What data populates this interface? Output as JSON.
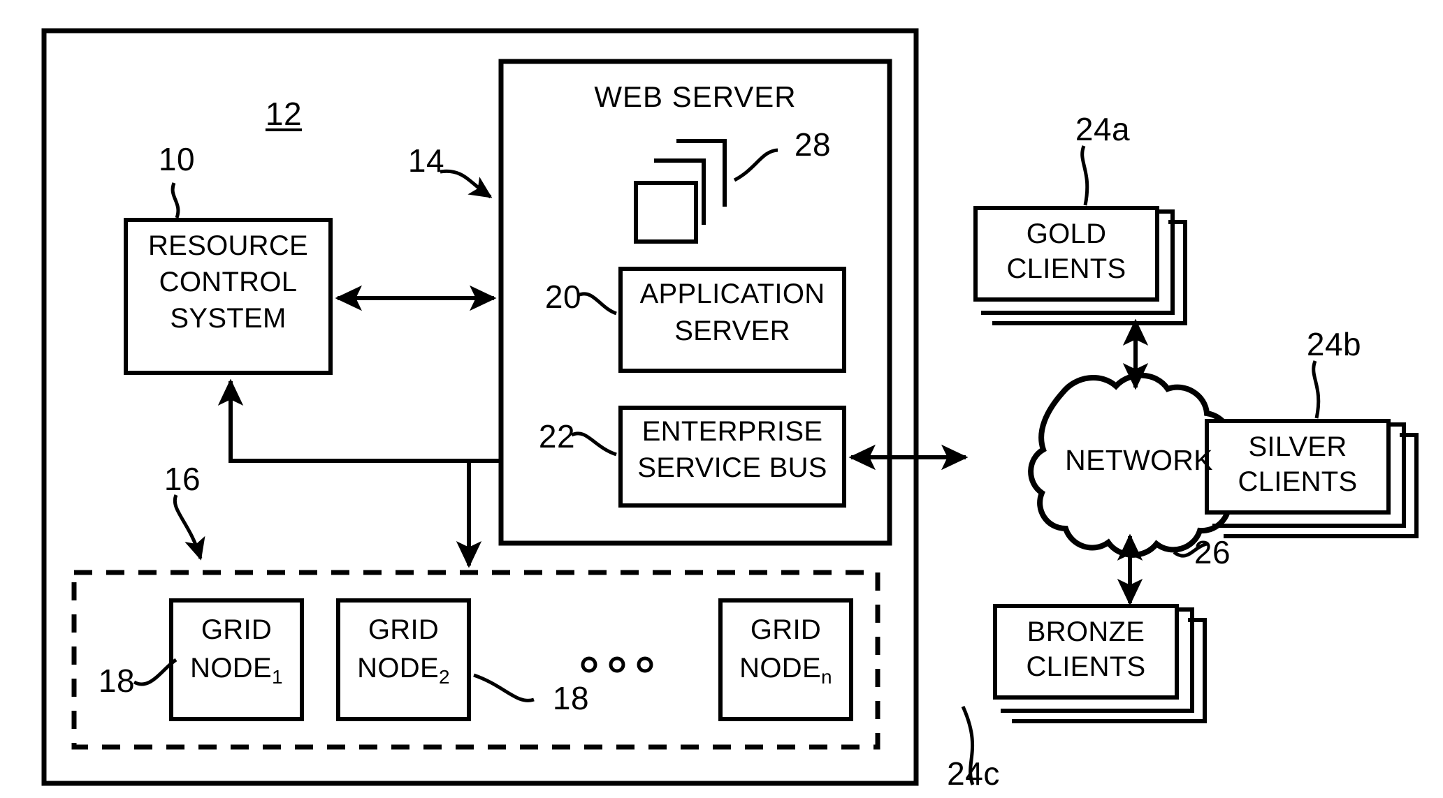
{
  "figure": {
    "type": "patent-block-diagram",
    "background": "#ffffff",
    "stroke": "#000000"
  },
  "outer_system": {
    "ref": "12"
  },
  "blocks": {
    "resource_control_system": {
      "ref": "10",
      "line1": "RESOURCE",
      "line2": "CONTROL",
      "line3": "SYSTEM"
    },
    "web_server": {
      "ref": "14",
      "title": "WEB SERVER"
    },
    "documents_stack": {
      "ref": "28",
      "icon": "stacked-pages-icon",
      "count": 3
    },
    "application_server": {
      "ref": "20",
      "line1": "APPLICATION",
      "line2": "SERVER"
    },
    "enterprise_service_bus": {
      "ref": "22",
      "line1": "ENTERPRISE",
      "line2": "SERVICE BUS"
    },
    "grid_group": {
      "ref": "16",
      "border": "dashed"
    }
  },
  "grid_nodes": [
    {
      "ref": "18",
      "ref_side": "left",
      "line1": "GRID",
      "line2": "NODE",
      "subscript": "1"
    },
    {
      "ref": "18",
      "ref_side": "right",
      "line1": "GRID",
      "line2": "NODE",
      "subscript": "2"
    },
    {
      "ref": "",
      "ref_side": "none",
      "line1": "GRID",
      "line2": "NODE",
      "subscript": "n"
    }
  ],
  "ellipsis": {
    "glyph": "circles",
    "count": 3
  },
  "network": {
    "ref": "26",
    "label": "NETWORK",
    "shape": "cloud"
  },
  "clients": [
    {
      "ref": "24a",
      "ref_side": "top",
      "line1": "GOLD",
      "line2": "CLIENTS",
      "stack": 3
    },
    {
      "ref": "24b",
      "ref_side": "top",
      "line1": "SILVER",
      "line2": "CLIENTS",
      "stack": 3
    },
    {
      "ref": "24c",
      "ref_side": "bottom-left",
      "line1": "BRONZE",
      "line2": "CLIENTS",
      "stack": 3
    }
  ]
}
